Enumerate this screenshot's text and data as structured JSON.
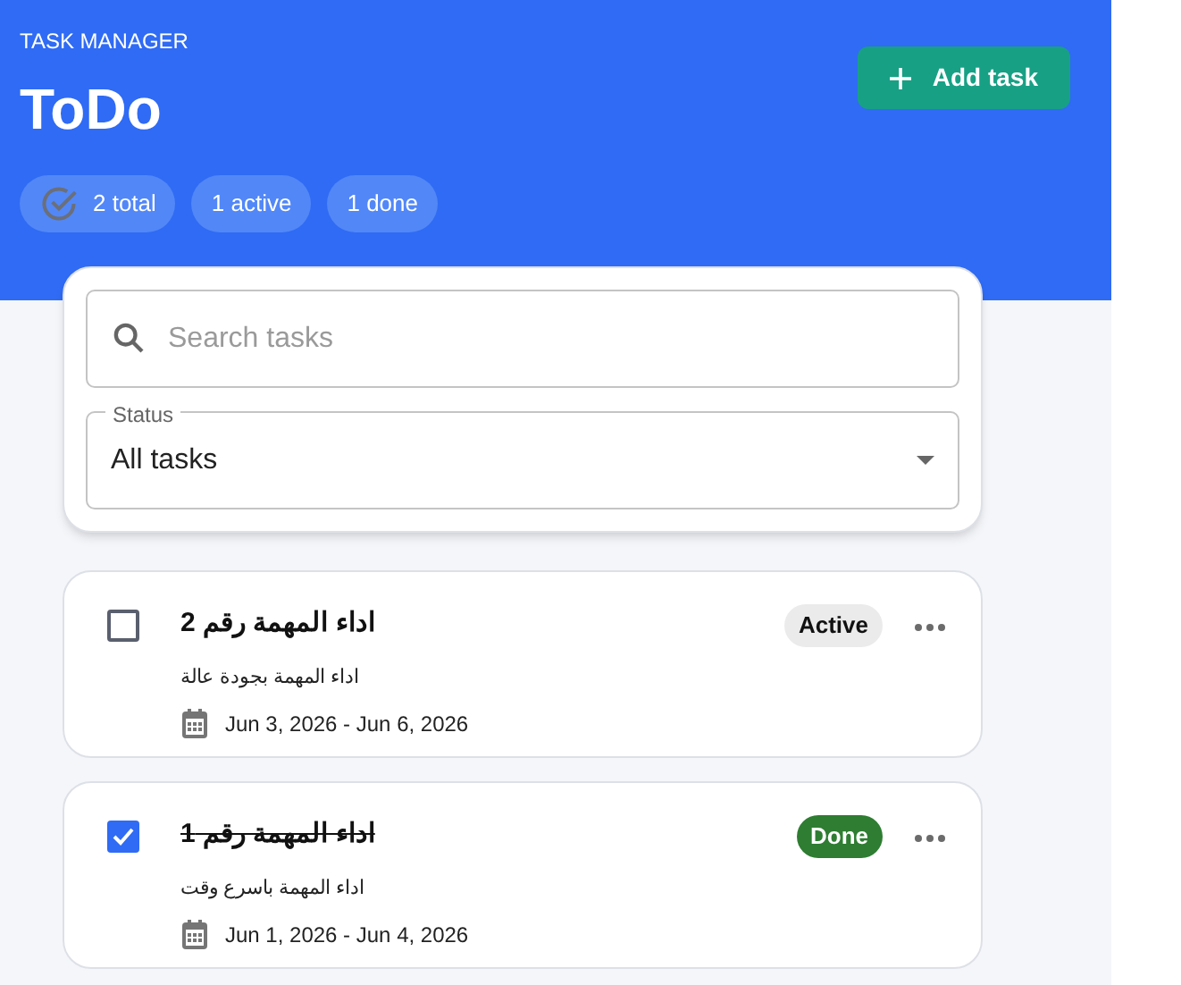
{
  "header": {
    "eyebrow": "TASK MANAGER",
    "title": "ToDo",
    "add_button": "Add task",
    "stats": [
      {
        "label": "2 total",
        "kind": "total"
      },
      {
        "label": "1 active",
        "kind": "plain"
      },
      {
        "label": "1 done",
        "kind": "plain"
      }
    ]
  },
  "filters": {
    "search": {
      "placeholder": "Search tasks"
    },
    "status": {
      "label": "Status",
      "value": "All tasks"
    }
  },
  "tasks": [
    {
      "title": "اداء المهمة رقم 2",
      "description": "اداء المهمة بجودة عالة",
      "dates": "Jun 3, 2026 - Jun 6, 2026",
      "badge": "Active",
      "checked": false
    },
    {
      "title": "اداء المهمة رقم 1",
      "description": "اداء المهمة باسرع وقت",
      "dates": "Jun 1, 2026 - Jun 4, 2026",
      "badge": "Done",
      "checked": true
    }
  ]
}
